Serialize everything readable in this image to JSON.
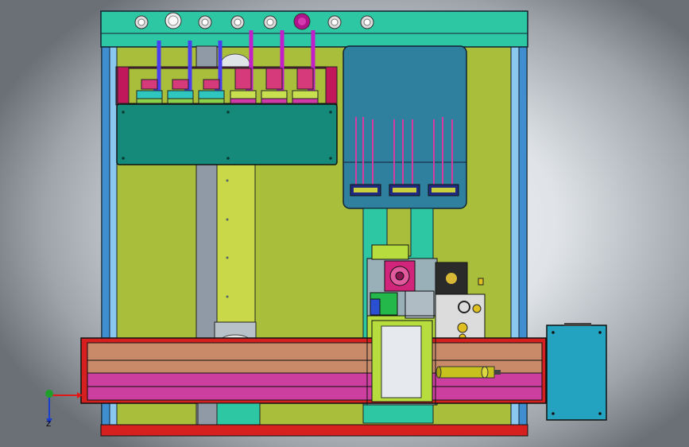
{
  "view": {
    "background": "gradient-grey-white",
    "axis_triad": {
      "vertical_axis_letter": "Z",
      "horizontal_axis_color": "#e01818",
      "vertical_axis_color": "#1a3fd0",
      "origin_color": "#1f9e2a"
    }
  },
  "colors": {
    "frame_top": "#2ec7a3",
    "frame_panel": "#a9bf3c",
    "aluminium_rail": "#3f8fd0",
    "slide_column": "#8f9aa6",
    "slide_rail_yellow": "#c9d848",
    "nozzle_block": "#158a7a",
    "nozzle_tube_blue": "#4a3ff0",
    "nozzle_tube_magenta": "#c21ec9",
    "pump_box": "#2f7f9e",
    "gantry_beam_salmon": "#c98a6a",
    "gantry_beam_pink": "#cc3f9f",
    "base_plate_red": "#d61f1f",
    "carriage_green": "#b7dc3e",
    "motor_magenta": "#d0257a",
    "electrical_box": "#23a3c0",
    "cylinder_yellow": "#c7c21e"
  },
  "icons": [
    "top-knob-icon",
    "emergency-stop-icon",
    "stepper-motor-icon",
    "axis-triad-icon"
  ]
}
